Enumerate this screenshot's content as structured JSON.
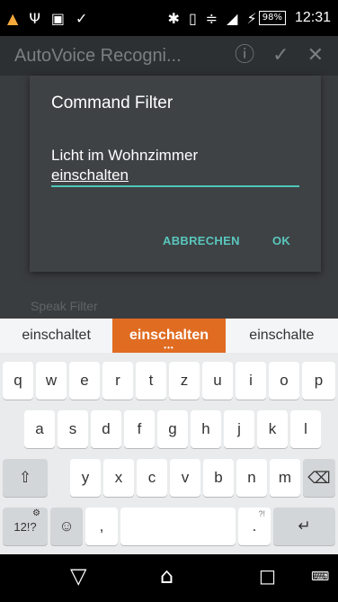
{
  "status_bar": {
    "battery": "98%",
    "time": "12:31"
  },
  "app_bar": {
    "title": "AutoVoice Recogni..."
  },
  "background": {
    "speak_filter_label": "Speak Filter"
  },
  "dialog": {
    "title": "Command Filter",
    "input_line1": "Licht im Wohnzimmer",
    "input_word": "einschalten",
    "cancel_label": "ABBRECHEN",
    "ok_label": "OK"
  },
  "keyboard": {
    "suggestions": [
      "einschaltet",
      "einschalten",
      "einschalte"
    ],
    "row1": [
      "q",
      "w",
      "e",
      "r",
      "t",
      "z",
      "u",
      "i",
      "o",
      "p"
    ],
    "row2": [
      "a",
      "s",
      "d",
      "f",
      "g",
      "h",
      "j",
      "k",
      "l"
    ],
    "row3": [
      "y",
      "x",
      "c",
      "v",
      "b",
      "n",
      "m"
    ],
    "symbols_label": "12!?",
    "comma_label": ",",
    "period_label": ".",
    "period_hint": "?!"
  },
  "colors": {
    "accent": "#4fc6bb",
    "suggestion_active": "#e06c22",
    "dialog_bg": "#3e4245"
  }
}
